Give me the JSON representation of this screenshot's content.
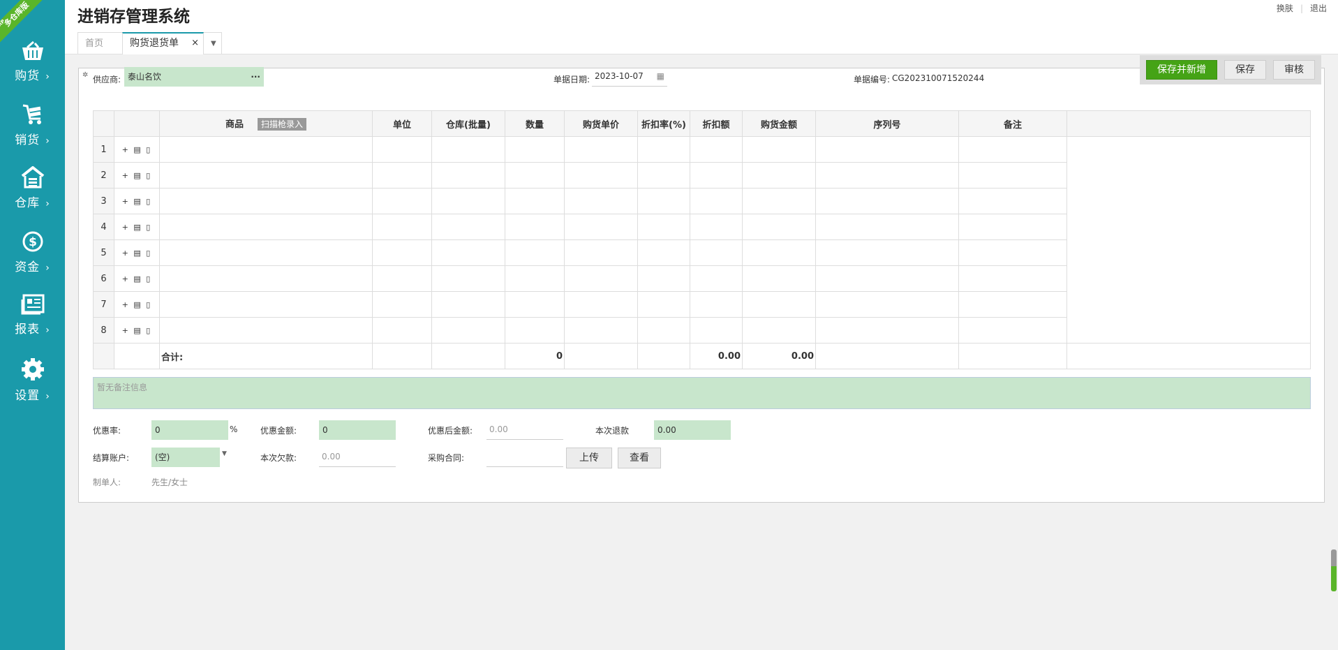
{
  "ribbon": {
    "small": "ERP",
    "text": "多仓库版"
  },
  "sidebar": {
    "items": [
      {
        "label": "购货",
        "icon": "basket-icon"
      },
      {
        "label": "销货",
        "icon": "cart-icon"
      },
      {
        "label": "仓库",
        "icon": "warehouse-icon"
      },
      {
        "label": "资金",
        "icon": "dollar-icon"
      },
      {
        "label": "报表",
        "icon": "report-icon"
      },
      {
        "label": "设置",
        "icon": "gear-icon"
      }
    ],
    "chevron": "›"
  },
  "header": {
    "title": "进销存管理系统",
    "links": [
      "换肤",
      "退出"
    ]
  },
  "tabs": [
    {
      "label": "首页"
    },
    {
      "label": "购货退货单",
      "close": "×"
    }
  ],
  "actions": {
    "save_new": "保存并新增",
    "save": "保存",
    "audit": "审核"
  },
  "form": {
    "supplier_label": "供应商:",
    "supplier_value": "泰山名饮",
    "date_label": "单据日期:",
    "date_value": "2023-10-07",
    "docno_label": "单据编号:",
    "docno_value": "CG202310071520244"
  },
  "grid": {
    "headers": [
      "商品",
      "单位",
      "仓库(批量)",
      "数量",
      "购货单价",
      "折扣率(%)",
      "折扣额",
      "购货金额",
      "序列号",
      "备注"
    ],
    "scan_badge": "扫描枪录入",
    "rows": [
      "1",
      "2",
      "3",
      "4",
      "5",
      "6",
      "7",
      "8"
    ],
    "ops": "+ 🗑 🛒",
    "total_label": "合计:",
    "total_qty": "0",
    "total_discount": "0.00",
    "total_amount": "0.00"
  },
  "remark_placeholder": "暂无备注信息",
  "footer": {
    "discount_rate_label": "优惠率:",
    "discount_rate_value": "0",
    "percent": "%",
    "discount_amt_label": "优惠金额:",
    "discount_amt_value": "0",
    "after_discount_label": "优惠后金额:",
    "after_discount_value": "0.00",
    "refund_label": "本次退款",
    "refund_value": "0.00",
    "account_label": "结算账户:",
    "account_value": "(空)",
    "owed_label": "本次欠款:",
    "owed_value": "0.00",
    "contract_label": "采购合同:",
    "upload": "上传",
    "view": "查看",
    "maker_label": "制单人:",
    "maker_value": "先生/女士"
  }
}
